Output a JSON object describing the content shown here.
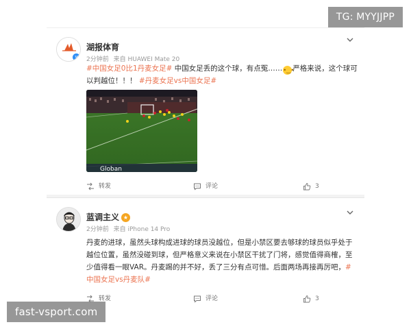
{
  "watermarks": {
    "top": "TG: MYYJJPP",
    "bottom": "fast-vsport.com"
  },
  "posts": [
    {
      "author": "湖报体育",
      "avatar_text": "湖报体育",
      "verified": true,
      "time": "2分钟前",
      "source": "来自 HUAWEI Mate 20",
      "text_segments": [
        {
          "text": "#中国女足0比1丹麦女足#",
          "type": "topic"
        },
        {
          "text": " 中国女足丢的这个球，有点冤……",
          "type": "text"
        },
        {
          "text": "严格来说，这个球可以判越位！！！ ",
          "type": "text"
        },
        {
          "text": "#丹麦女足vs中国女足#",
          "type": "topic"
        }
      ],
      "has_image": true,
      "image_caption": "Globan",
      "actions": {
        "repost": "转发",
        "comment": "评论",
        "like": "3"
      }
    },
    {
      "author": "蓝调主义",
      "avatar_text": "",
      "verified": false,
      "time": "2分钟前",
      "source": "来自 iPhone 14 Pro",
      "text_segments": [
        {
          "text": "丹麦的进球，虽然头球构成进球的球员没越位，但是小禁区要去够球的球员似乎处于越位位置，虽然没碰到球，但严格意义来说在小禁区干扰了门将，感觉值得商榷，至少值得看一眼VAR。丹麦踢的并不好，丢了三分有点可惜。后面两场再接再厉吧，",
          "type": "text"
        },
        {
          "text": "#中国女足vs丹麦队#",
          "type": "topic"
        }
      ],
      "has_image": false,
      "actions": {
        "repost": "转发",
        "comment": "评论",
        "like": "3"
      }
    }
  ],
  "colors": {
    "topic": "#eb7350",
    "verified": "#2e8ef5",
    "accent": "#f5a623"
  }
}
